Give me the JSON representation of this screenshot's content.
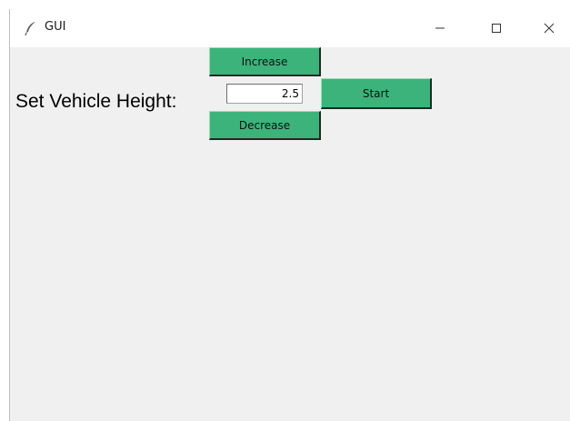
{
  "window": {
    "title": "GUI",
    "icon": "feather-icon",
    "controls": {
      "minimize": "—",
      "maximize": "☐",
      "close": "✕"
    }
  },
  "form": {
    "label": "Set Vehicle Height:",
    "height_value": "2.5",
    "increase_label": "Increase",
    "decrease_label": "Decrease",
    "start_label": "Start"
  },
  "colors": {
    "button_green": "#3cb37a",
    "background": "#f0f0f0"
  }
}
